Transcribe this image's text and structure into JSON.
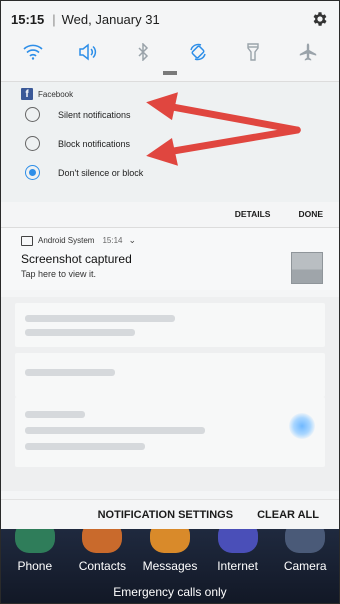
{
  "status": {
    "time": "15:15",
    "date": "Wed, January 31"
  },
  "quick_settings": [
    "wifi-icon",
    "volume-icon",
    "bluetooth-icon",
    "auto-rotate-icon",
    "flashlight-icon",
    "airplane-icon"
  ],
  "facebook_card": {
    "app_name": "Facebook",
    "options": [
      {
        "label": "Silent notifications",
        "checked": false
      },
      {
        "label": "Block notifications",
        "checked": false
      },
      {
        "label": "Don't silence or block",
        "checked": true
      }
    ],
    "details_label": "DETAILS",
    "done_label": "DONE"
  },
  "screenshot_card": {
    "source": "Android System",
    "time": "15:14",
    "title": "Screenshot captured",
    "subtitle": "Tap here to view it."
  },
  "bottom_actions": {
    "notification_settings": "NOTIFICATION SETTINGS",
    "clear_all": "CLEAR ALL"
  },
  "dock": {
    "items": [
      {
        "label": "Phone",
        "color": "#2f7d5a"
      },
      {
        "label": "Contacts",
        "color": "#c96a2c"
      },
      {
        "label": "Messages",
        "color": "#d98a2a"
      },
      {
        "label": "Internet",
        "color": "#4a4fb8"
      },
      {
        "label": "Camera",
        "color": "#4a5a78"
      }
    ]
  },
  "emergency_text": "Emergency calls only",
  "colors": {
    "accent": "#2d8ee8",
    "arrow": "#e0463f"
  }
}
